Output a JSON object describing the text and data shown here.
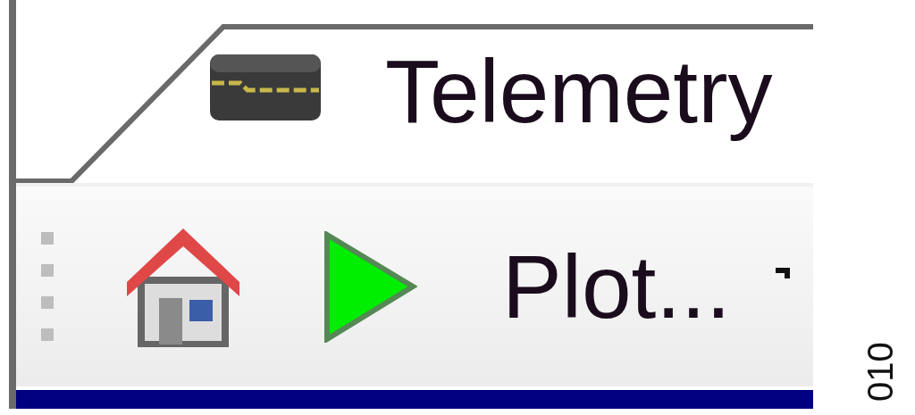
{
  "tab": {
    "label": "Telemetry"
  },
  "toolbar": {
    "button_label": "Plot..."
  },
  "figure_label": "010"
}
